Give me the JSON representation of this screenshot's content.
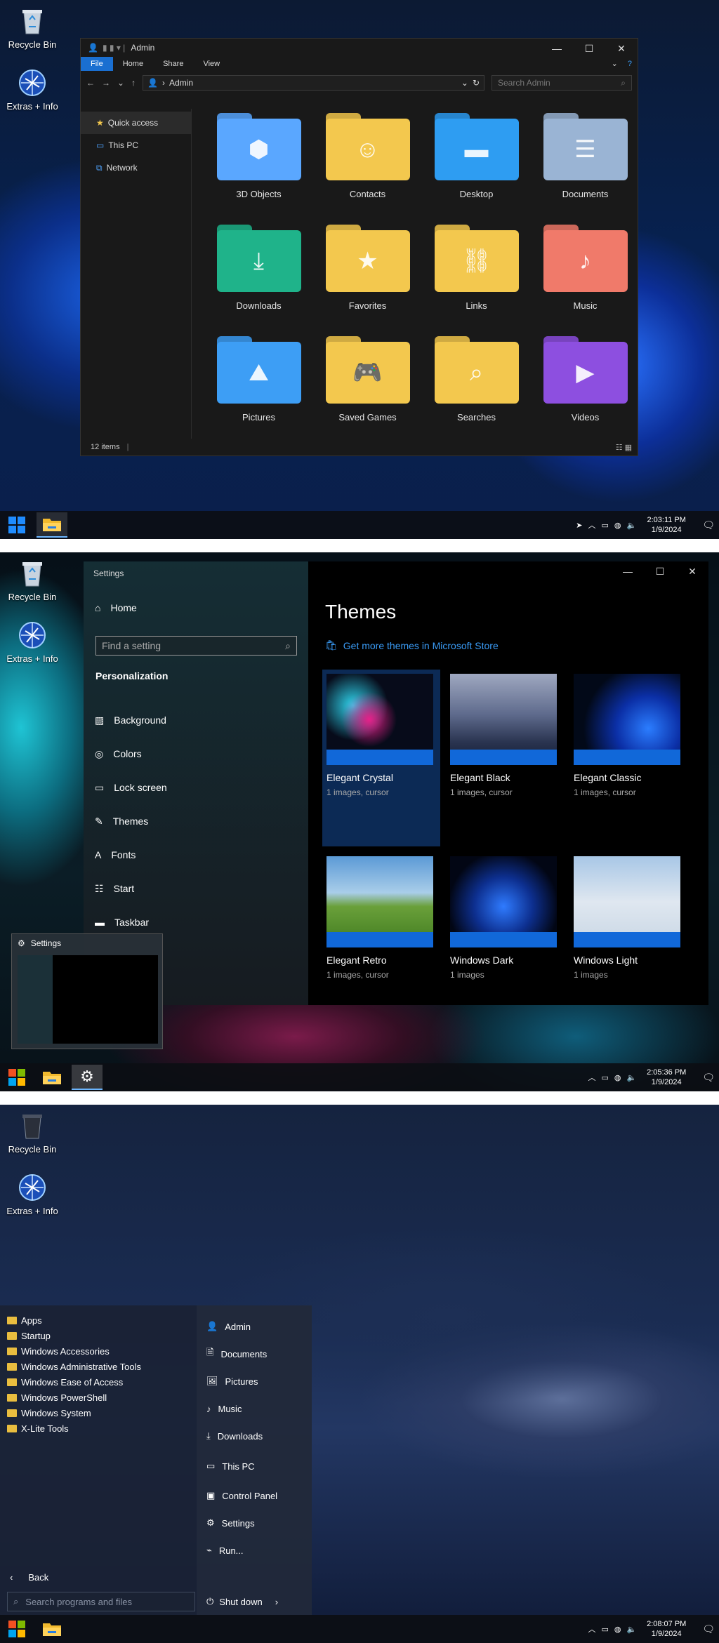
{
  "desktop": {
    "icons": [
      {
        "label": "Recycle Bin"
      },
      {
        "label": "Extras + Info"
      }
    ]
  },
  "screen1": {
    "explorer": {
      "title": "Admin",
      "ribbon_tabs": [
        "File",
        "Home",
        "Share",
        "View"
      ],
      "breadcrumb": "Admin",
      "search_placeholder": "Search Admin",
      "nav": [
        "Quick access",
        "This PC",
        "Network"
      ],
      "items": [
        {
          "label": "3D Objects",
          "color": "#5aa7ff"
        },
        {
          "label": "Contacts",
          "color": "#f3c84e"
        },
        {
          "label": "Desktop",
          "color": "#2e9df2"
        },
        {
          "label": "Documents",
          "color": "#9ab4d4"
        },
        {
          "label": "Downloads",
          "color": "#1fb38a"
        },
        {
          "label": "Favorites",
          "color": "#f3c84e"
        },
        {
          "label": "Links",
          "color": "#f3c84e"
        },
        {
          "label": "Music",
          "color": "#f07a6a"
        },
        {
          "label": "Pictures",
          "color": "#3d9ef5"
        },
        {
          "label": "Saved Games",
          "color": "#f3c84e"
        },
        {
          "label": "Searches",
          "color": "#f3c84e"
        },
        {
          "label": "Videos",
          "color": "#8d4fe0"
        }
      ],
      "status": "12 items"
    },
    "clock": {
      "time": "2:03:11 PM",
      "date": "1/9/2024"
    }
  },
  "screen2": {
    "settings": {
      "title": "Settings",
      "home": "Home",
      "search_placeholder": "Find a setting",
      "category": "Personalization",
      "nav": [
        "Background",
        "Colors",
        "Lock screen",
        "Themes",
        "Fonts",
        "Start",
        "Taskbar"
      ],
      "heading": "Themes",
      "store_link": "Get more themes in Microsoft Store",
      "themes": [
        {
          "name": "Elegant Crystal",
          "sub": "1 images, cursor"
        },
        {
          "name": "Elegant Black",
          "sub": "1 images, cursor"
        },
        {
          "name": "Elegant Classic",
          "sub": "1 images, cursor"
        },
        {
          "name": "Elegant Retro",
          "sub": "1 images, cursor"
        },
        {
          "name": "Windows Dark",
          "sub": "1 images"
        },
        {
          "name": "Windows Light",
          "sub": "1 images"
        }
      ]
    },
    "preview": {
      "title": "Settings"
    },
    "clock": {
      "time": "2:05:36 PM",
      "date": "1/9/2024"
    }
  },
  "screen3": {
    "start": {
      "programs": [
        "Apps",
        "Startup",
        "Windows Accessories",
        "Windows Administrative Tools",
        "Windows Ease of Access",
        "Windows PowerShell",
        "Windows System",
        "X-Lite Tools"
      ],
      "places": [
        "Admin",
        "Documents",
        "Pictures",
        "Music",
        "Downloads",
        "This PC",
        "Control Panel",
        "Settings",
        "Run..."
      ],
      "back": "Back",
      "search_placeholder": "Search programs and files",
      "shutdown": "Shut down"
    },
    "clock": {
      "time": "2:08:07 PM",
      "date": "1/9/2024"
    }
  }
}
